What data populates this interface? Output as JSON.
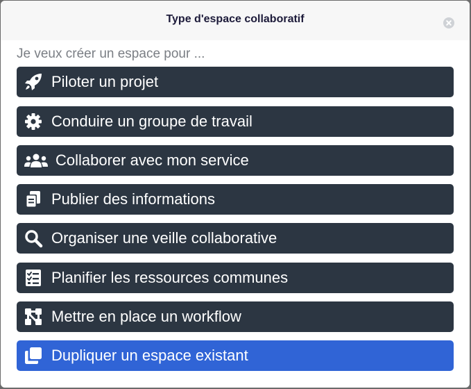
{
  "dialog": {
    "title": "Type d'espace collaboratif",
    "close_icon": "close-circle-icon"
  },
  "prompt": "Je veux créer un espace pour ...",
  "options": [
    {
      "label": "Piloter un projet",
      "icon": "rocket-icon",
      "selected": false
    },
    {
      "label": "Conduire un groupe de travail",
      "icon": "gear-icon",
      "selected": false
    },
    {
      "label": "Collaborer avec mon service",
      "icon": "users-icon",
      "selected": false
    },
    {
      "label": "Publier des informations",
      "icon": "documents-icon",
      "selected": false
    },
    {
      "label": "Organiser une veille collaborative",
      "icon": "search-icon",
      "selected": false
    },
    {
      "label": "Planifier les ressources communes",
      "icon": "checklist-icon",
      "selected": false
    },
    {
      "label": "Mettre en place un workflow",
      "icon": "workflow-icon",
      "selected": false
    },
    {
      "label": "Dupliquer un espace existant",
      "icon": "copy-icon",
      "selected": true
    }
  ],
  "colors": {
    "option_bg": "#2c3642",
    "option_selected_bg": "#3064d6",
    "title_color": "#1d1b3a",
    "prompt_color": "#7a7e84"
  }
}
